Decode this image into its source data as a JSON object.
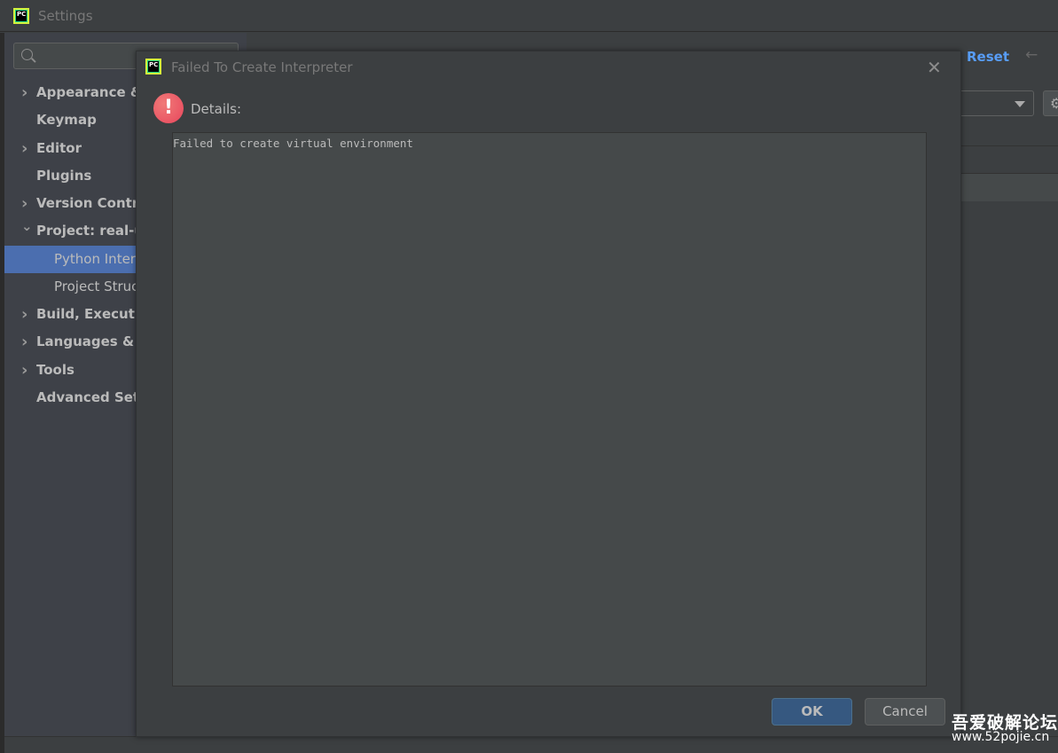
{
  "window": {
    "title": "Settings",
    "icon": "pycharm-icon"
  },
  "sidebar": {
    "search_placeholder": "",
    "items": [
      {
        "label": "Appearance & Behavior",
        "expandable": true
      },
      {
        "label": "Keymap",
        "expandable": false
      },
      {
        "label": "Editor",
        "expandable": true
      },
      {
        "label": "Plugins",
        "expandable": false
      },
      {
        "label": "Version Control",
        "expandable": true
      },
      {
        "label": "Project: real-url",
        "expandable": true,
        "expanded": true
      },
      {
        "label": "Python Interpreter",
        "child": true,
        "selected": true
      },
      {
        "label": "Project Structure",
        "child": true
      },
      {
        "label": "Build, Execution, Deployment",
        "expandable": true
      },
      {
        "label": "Languages & Frameworks",
        "expandable": true
      },
      {
        "label": "Tools",
        "expandable": true
      },
      {
        "label": "Advanced Settings",
        "expandable": false
      }
    ]
  },
  "right_panel": {
    "reset_label": "Reset"
  },
  "dialog": {
    "title": "Failed To Create Interpreter",
    "details_label": "Details:",
    "details_text": "Failed to create virtual environment",
    "ok_label": "OK",
    "cancel_label": "Cancel"
  },
  "watermark": {
    "line1": "吾爱破解论坛",
    "line2": "www.52pojie.cn"
  },
  "colors": {
    "accent": "#4b6eaf",
    "link": "#589df6",
    "error": "#e8465c"
  }
}
